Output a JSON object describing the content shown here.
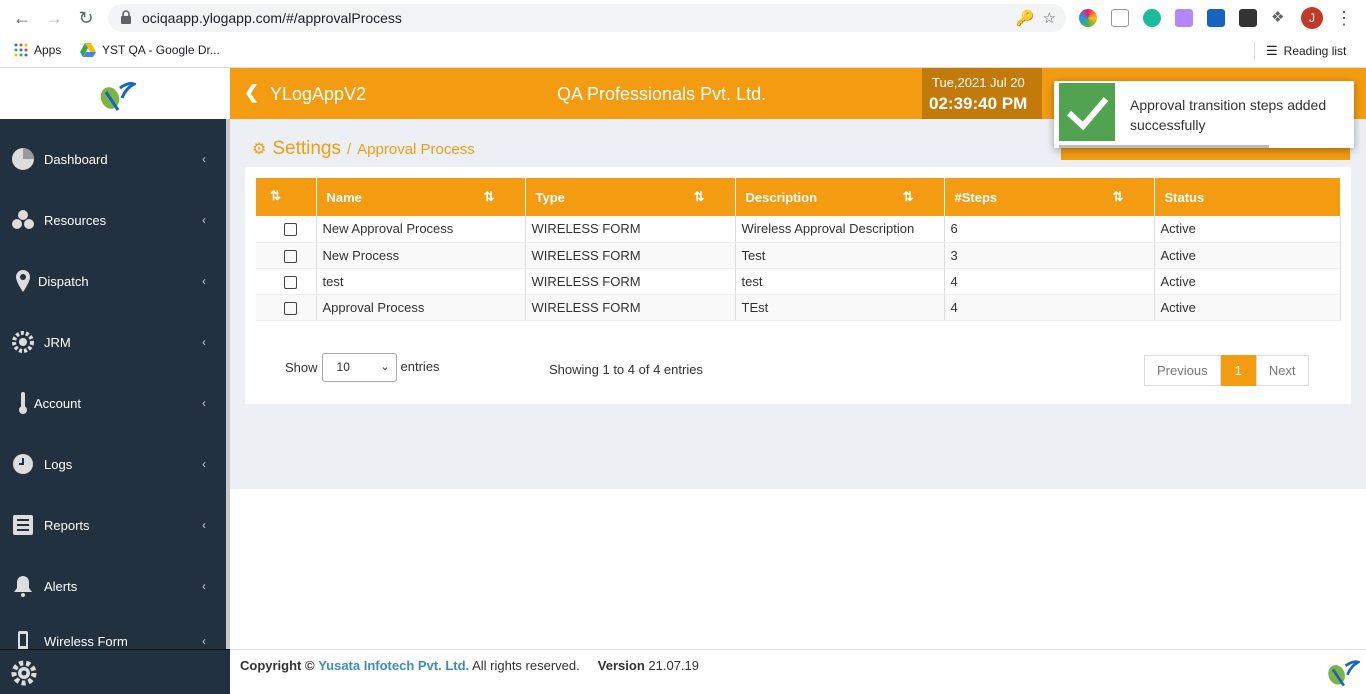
{
  "browser": {
    "url": "ociqaapp.ylogapp.com/#/approvalProcess",
    "avatar_letter": "J",
    "bookmarks": {
      "apps": "Apps",
      "drive": "YST QA - Google Dr...",
      "reading_list": "Reading list"
    }
  },
  "header": {
    "app_name": "YLogAppV2",
    "company": "QA Professionals Pvt. Ltd.",
    "date": "Tue,2021 Jul 20",
    "time": "02:39:40 PM"
  },
  "sidebar": {
    "items": [
      {
        "label": "Dashboard",
        "icon": "dashboard-icon"
      },
      {
        "label": "Resources",
        "icon": "resources-icon"
      },
      {
        "label": "Dispatch",
        "icon": "map-pin-icon"
      },
      {
        "label": "JRM",
        "icon": "gear-cog-icon"
      },
      {
        "label": "Account",
        "icon": "thermometer-icon"
      },
      {
        "label": "Logs",
        "icon": "clock-icon"
      },
      {
        "label": "Reports",
        "icon": "report-icon"
      },
      {
        "label": "Alerts",
        "icon": "bell-icon"
      },
      {
        "label": "Wireless Form",
        "icon": "mobile-icon"
      }
    ]
  },
  "breadcrumb": {
    "title": "Settings",
    "separator": "/",
    "sub": "Approval Process"
  },
  "table": {
    "columns": [
      "Name",
      "Type",
      "Description",
      "#Steps",
      "Status"
    ],
    "rows": [
      {
        "name": "New Approval Process",
        "type": "WIRELESS FORM",
        "description": "Wireless Approval Description",
        "steps": "6",
        "status": "Active"
      },
      {
        "name": "New Process",
        "type": "WIRELESS FORM",
        "description": "Test",
        "steps": "3",
        "status": "Active"
      },
      {
        "name": "test",
        "type": "WIRELESS FORM",
        "description": "test",
        "steps": "4",
        "status": "Active"
      },
      {
        "name": "Approval Process",
        "type": "WIRELESS FORM",
        "description": "TEst",
        "steps": "4",
        "status": "Active"
      }
    ]
  },
  "pagination": {
    "show_label": "Show",
    "entries_value": "10",
    "entries_label": "entries",
    "info": "Showing 1 to 4 of 4 entries",
    "previous": "Previous",
    "current_page": "1",
    "next": "Next"
  },
  "footer": {
    "copyright": "Copyright ©",
    "company": "Yusata Infotech Pvt. Ltd.",
    "rights": "All rights reserved.",
    "version_label": "Version",
    "version": "21.07.19"
  },
  "toast": {
    "message": "Approval transition steps added successfully"
  },
  "colors": {
    "brand_orange": "#f39c12",
    "sidebar_bg": "#22313f",
    "success_green": "#51a351"
  }
}
